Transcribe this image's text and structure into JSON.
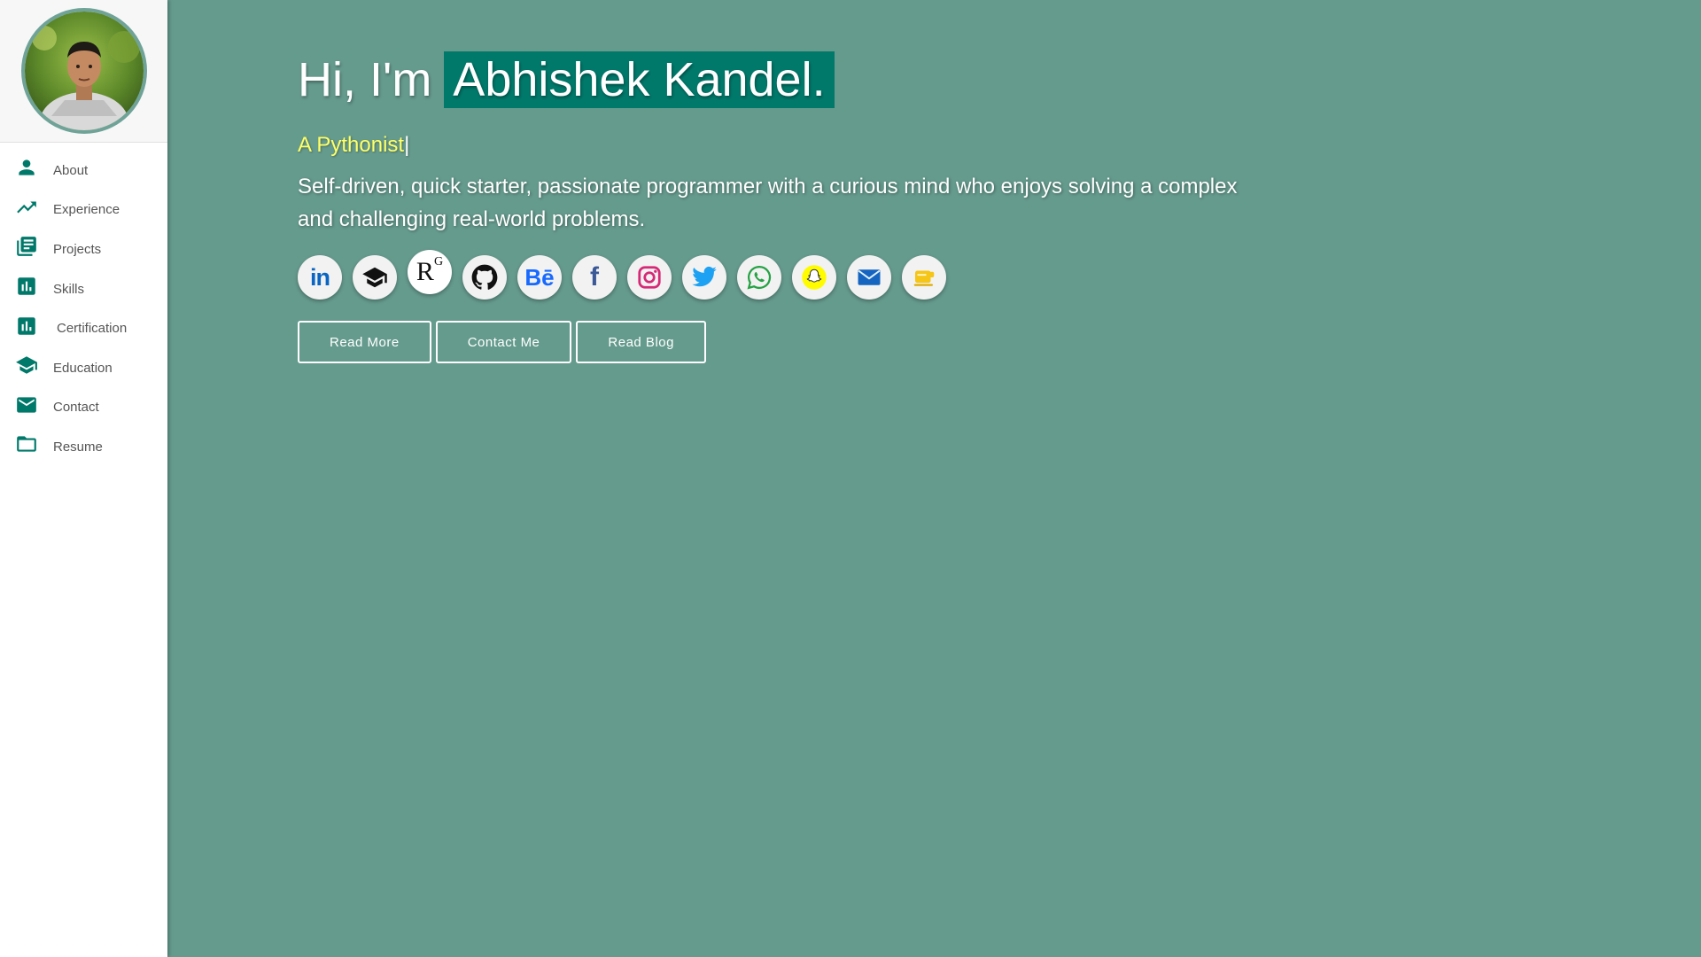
{
  "sidebar": {
    "avatar_icon": "profile-photo",
    "items": [
      {
        "label": "About",
        "icon": "person-icon"
      },
      {
        "label": "Experience",
        "icon": "trending-up-icon"
      },
      {
        "label": "Projects",
        "icon": "library-books-icon"
      },
      {
        "label": "Skills",
        "icon": "bar-chart-icon"
      },
      {
        "label": "Certification",
        "icon": "bar-chart-icon"
      },
      {
        "label": "Education",
        "icon": "school-icon"
      },
      {
        "label": "Contact",
        "icon": "mail-icon"
      },
      {
        "label": "Resume",
        "icon": "folder-icon"
      }
    ]
  },
  "hero": {
    "greeting": "Hi, I'm",
    "name": "Abhishek Kandel.",
    "typed_text": "A Pythonist",
    "typed_cursor": "|",
    "bio": "Self-driven, quick starter, passionate programmer with a curious mind who enjoys solving a complex and challenging real-world problems."
  },
  "socials": [
    {
      "name": "linkedin-icon",
      "text": "in"
    },
    {
      "name": "graduation-cap-icon"
    },
    {
      "name": "researchgate-icon",
      "text": "R",
      "sup": "G"
    },
    {
      "name": "github-icon"
    },
    {
      "name": "behance-icon",
      "text": "Bē"
    },
    {
      "name": "facebook-icon",
      "text": "f"
    },
    {
      "name": "instagram-icon"
    },
    {
      "name": "twitter-icon"
    },
    {
      "name": "whatsapp-icon"
    },
    {
      "name": "snapchat-icon"
    },
    {
      "name": "email-icon"
    },
    {
      "name": "coffee-icon"
    }
  ],
  "buttons": {
    "read_more": "Read More",
    "contact_me": "Contact Me",
    "read_blog": "Read Blog"
  },
  "colors": {
    "background": "#659b8d",
    "accent": "#00796b",
    "typed": "#ffff66",
    "sidebar": "#ffffff"
  }
}
